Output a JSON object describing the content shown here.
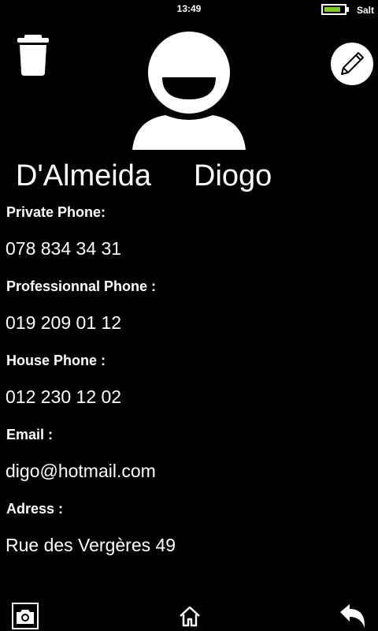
{
  "status_bar": {
    "time": "13:49",
    "carrier": "Salt",
    "battery_level": 0.85,
    "battery_color": "#7bd11a"
  },
  "contact": {
    "last_name": "D'Almeida",
    "first_name": "Diogo",
    "fields": [
      {
        "label": "Private Phone:",
        "value": "078 834 34 31"
      },
      {
        "label": "Professionnal Phone :",
        "value": "019 209 01 12"
      },
      {
        "label": "House Phone :",
        "value": "012 230 12 02"
      },
      {
        "label": "Email :",
        "value": "digo@hotmail.com"
      },
      {
        "label": "Adress :",
        "value": "Rue des Vergères 49"
      }
    ]
  },
  "icons": {
    "delete": "trash-icon",
    "edit": "pencil-icon",
    "avatar": "avatar-icon",
    "camera": "camera-icon",
    "home": "home-icon",
    "back": "back-arrow-icon"
  }
}
